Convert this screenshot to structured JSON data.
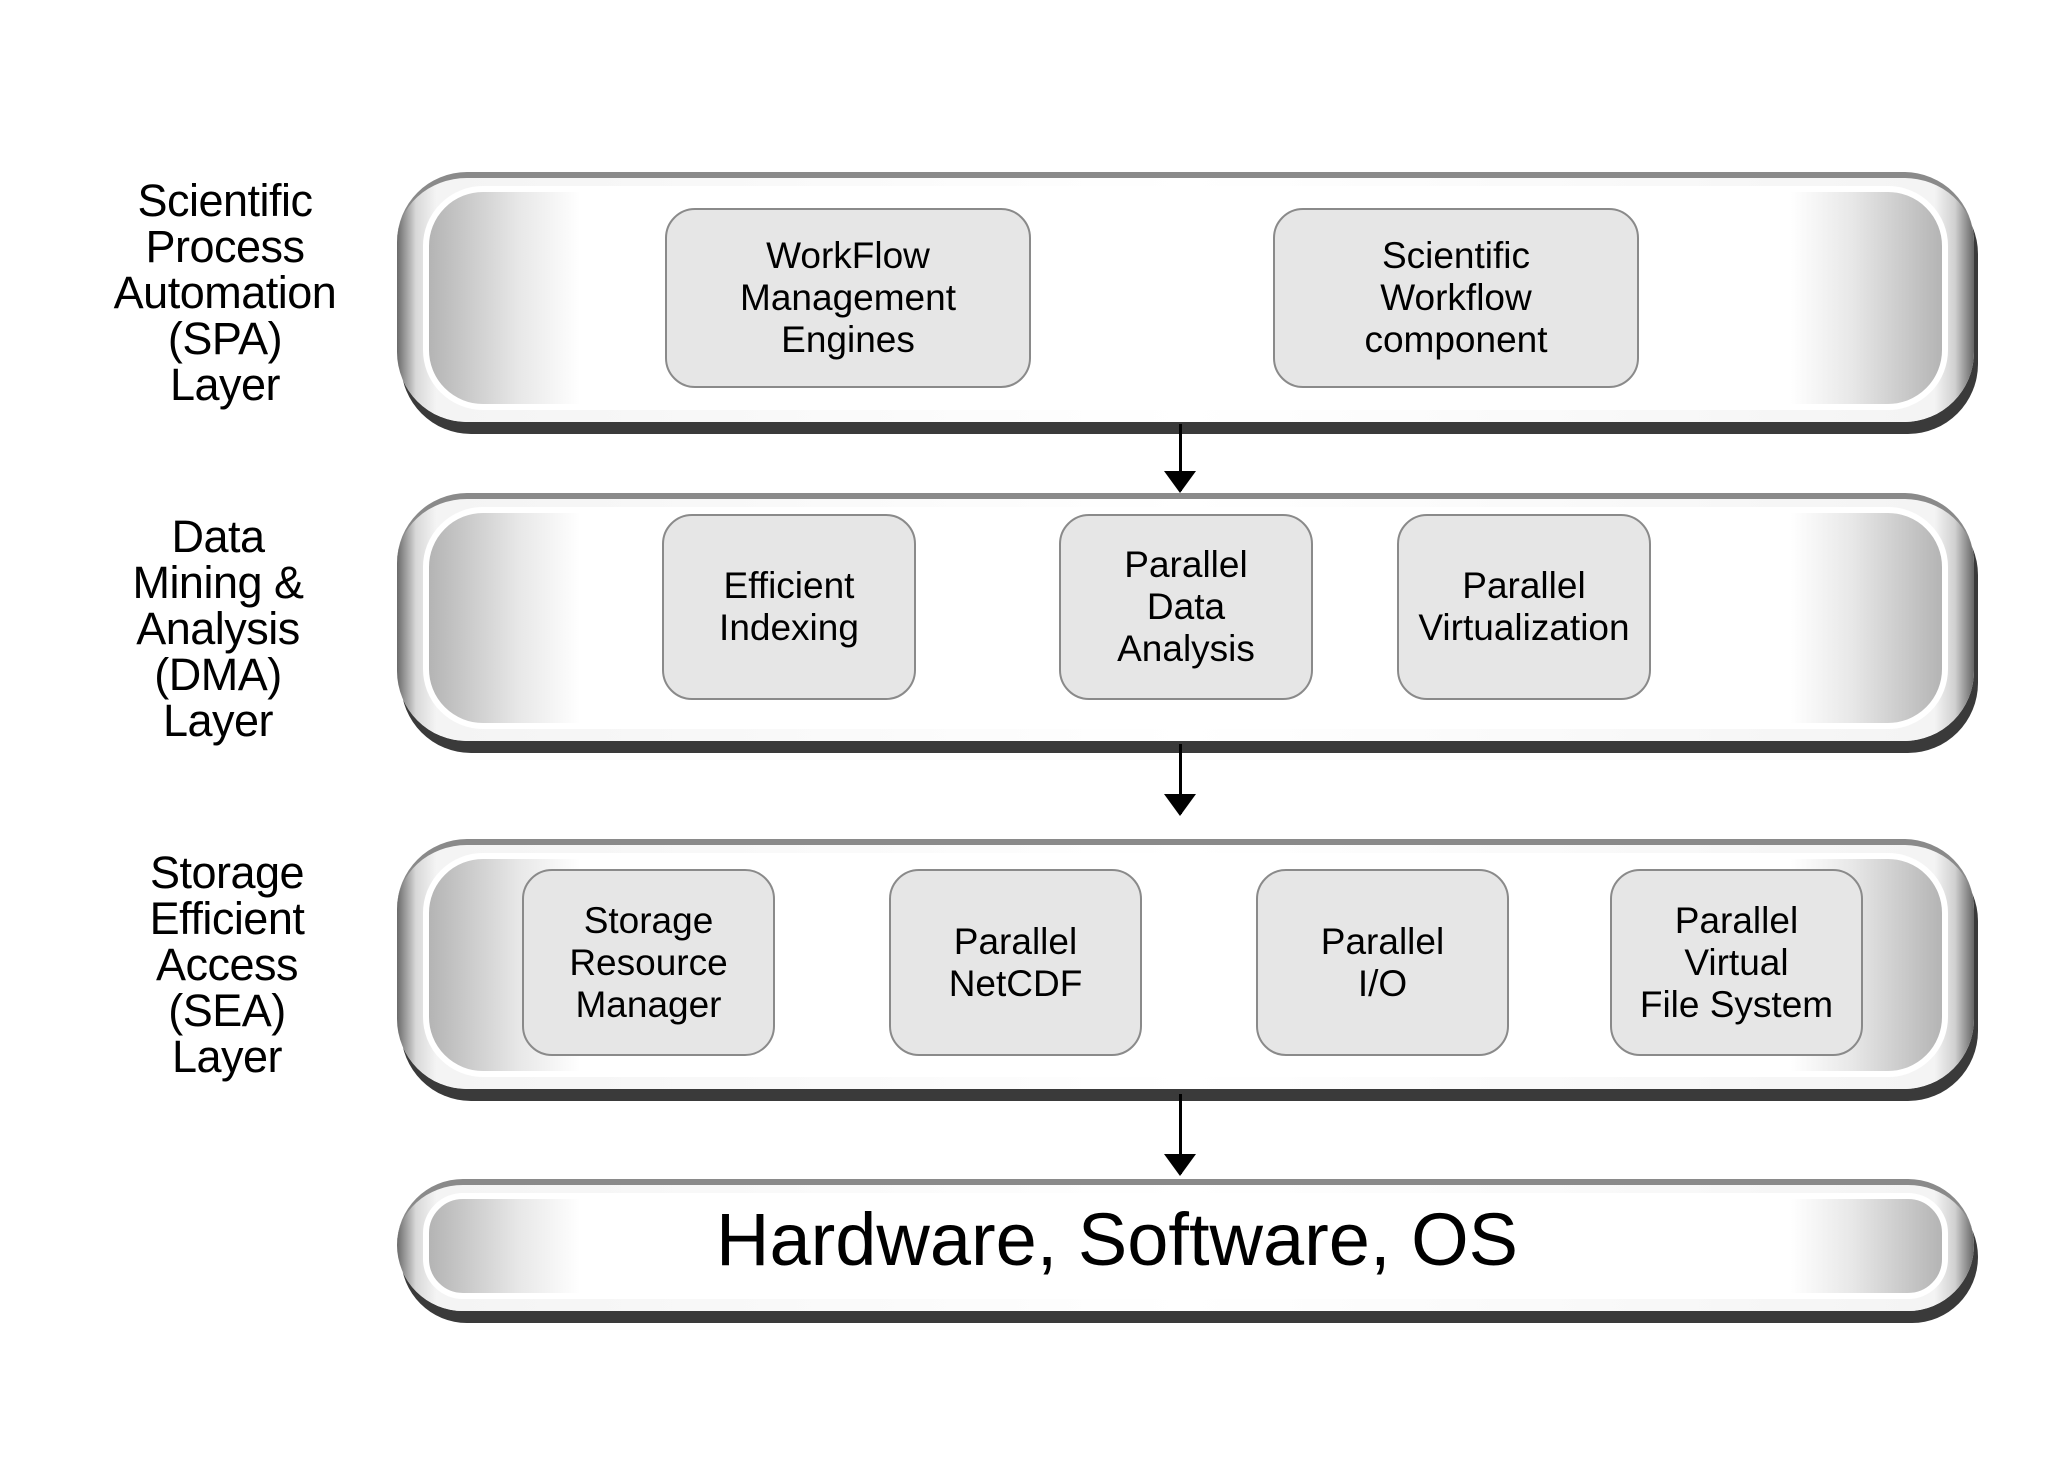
{
  "layers": [
    {
      "label": "Scientific\nProcess\nAutomation\n(SPA)\nLayer",
      "components": [
        "WorkFlow\nManagement\nEngines",
        "Scientific\nWorkflow\ncomponent"
      ]
    },
    {
      "label": "Data\nMining  &\nAnalysis\n(DMA)\nLayer",
      "components": [
        "Efficient\nIndexing",
        "Parallel\nData\nAnalysis",
        "Parallel\nVirtualization"
      ]
    },
    {
      "label": "Storage\nEfficient\nAccess\n(SEA)\nLayer",
      "components": [
        "Storage\nResource\nManager",
        "Parallel\nNetCDF",
        "Parallel\nI/O",
        "Parallel\nVirtual\nFile  System"
      ]
    }
  ],
  "base": {
    "label": "Hardware,  Software,  OS"
  }
}
